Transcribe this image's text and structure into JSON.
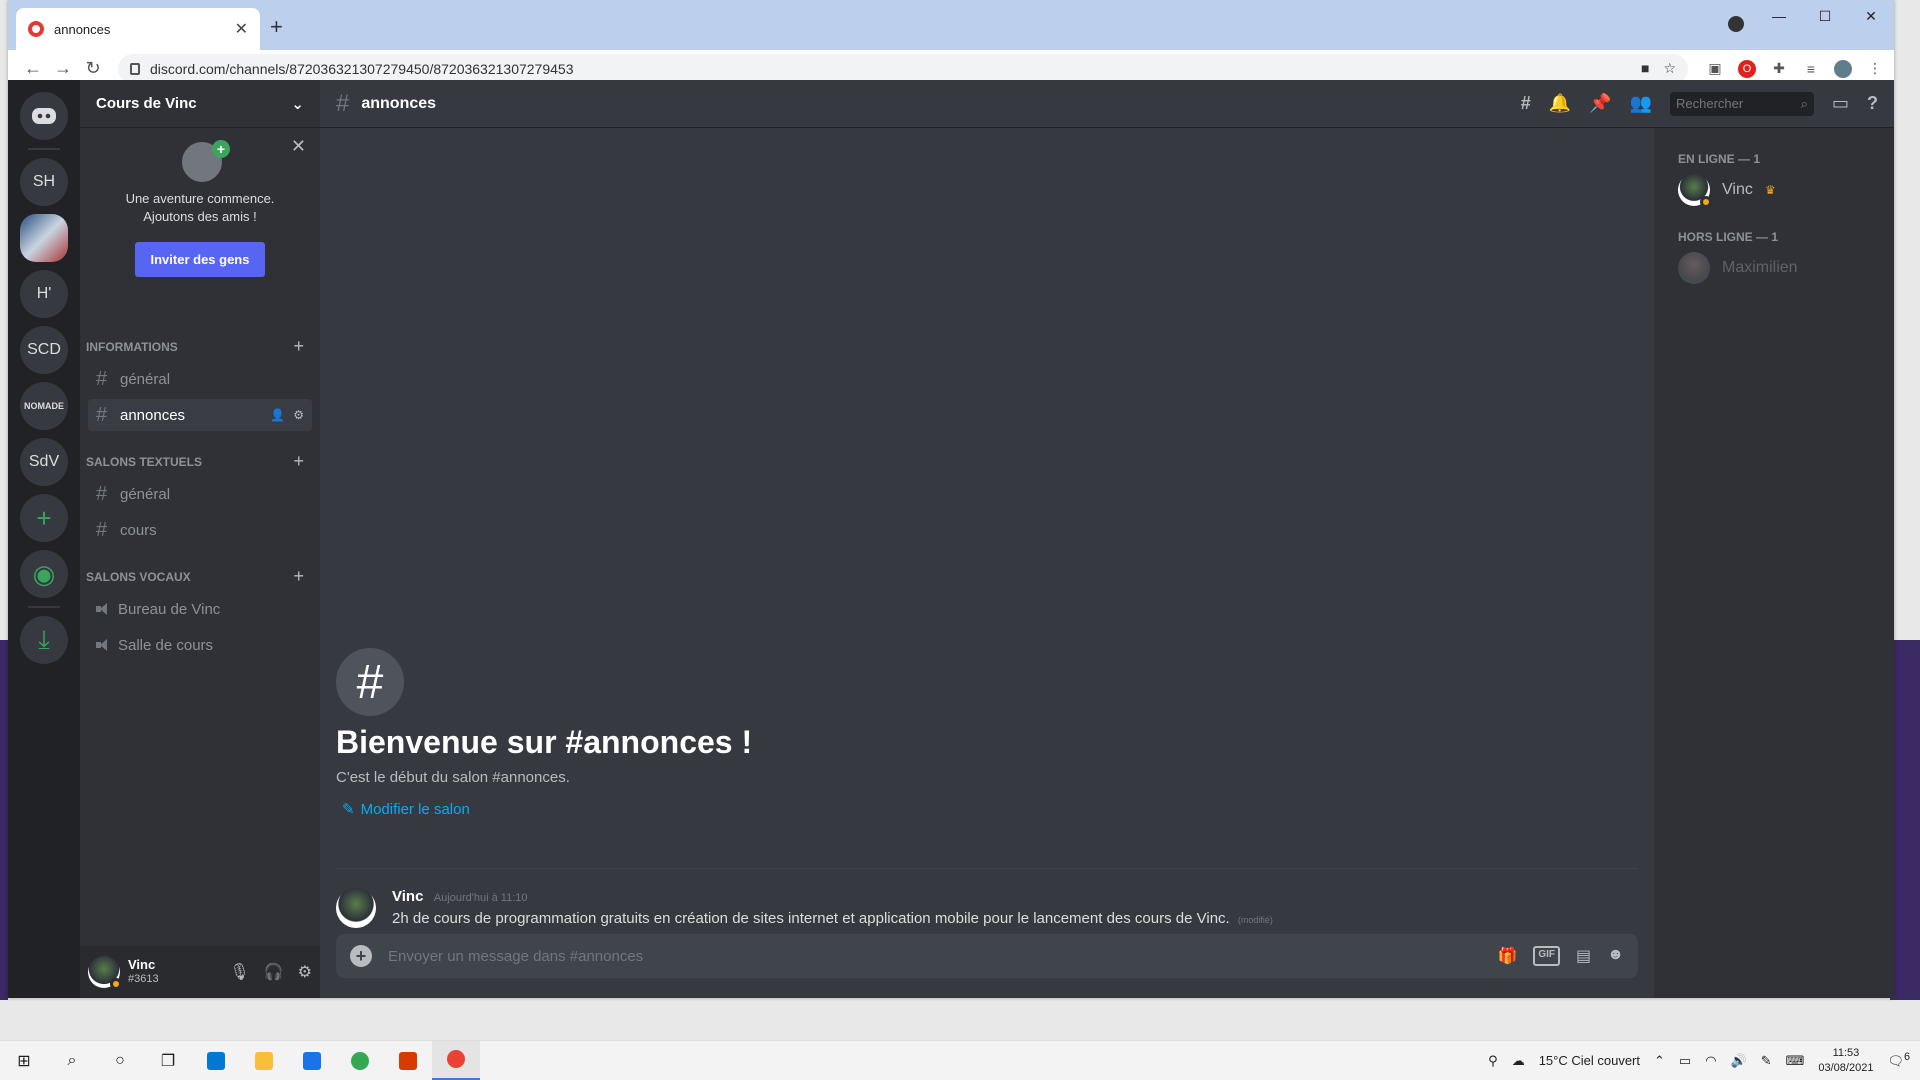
{
  "browser": {
    "tab_title": "annonces",
    "url": "discord.com/channels/872036321307279450/872036321307279453"
  },
  "guilds": [
    "SH",
    "H'",
    "SCD",
    "SdV"
  ],
  "nomad_label": "NOMADE",
  "server": {
    "name": "Cours de Vinc",
    "invite_text_1": "Une aventure commence.",
    "invite_text_2": "Ajoutons des amis !",
    "invite_button": "Inviter des gens"
  },
  "categories": {
    "informations": "INFORMATIONS",
    "textuels": "SALONS TEXTUELS",
    "vocaux": "SALONS VOCAUX"
  },
  "channels": {
    "info_general": "général",
    "annonces": "annonces",
    "text_general": "général",
    "cours": "cours",
    "voice_1": "Bureau de Vinc",
    "voice_2": "Salle de cours"
  },
  "user": {
    "name": "Vinc",
    "tag": "#3613"
  },
  "header": {
    "channel": "annonces",
    "search_placeholder": "Rechercher"
  },
  "welcome": {
    "title": "Bienvenue sur #annonces !",
    "subtitle": "C'est le début du salon #annonces.",
    "edit_link": "Modifier le salon"
  },
  "message": {
    "author": "Vinc",
    "time": "Aujourd'hui à 11:10",
    "text": "2h de cours  de programmation gratuits en création de sites internet et application mobile pour le lancement des cours de Vinc.",
    "edited": "(modifié)"
  },
  "composer": {
    "placeholder": "Envoyer un message dans #annonces",
    "gif": "GIF"
  },
  "members": {
    "online_header": "EN LIGNE — 1",
    "online": "Vinc",
    "offline_header": "HORS LIGNE — 1",
    "offline": "Maximilien"
  },
  "taskbar": {
    "weather": "15°C  Ciel couvert",
    "time": "11:53",
    "date": "03/08/2021",
    "notifications": "6"
  }
}
